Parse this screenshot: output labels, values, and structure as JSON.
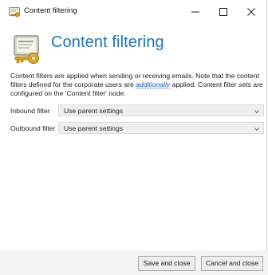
{
  "window": {
    "title": "Content filtering",
    "controls": {
      "minimize": "minimize-icon",
      "maximize": "maximize-icon",
      "close": "close-icon"
    }
  },
  "header": {
    "title": "Content filtering",
    "icon": "certificate-key-icon"
  },
  "description": {
    "part1": "Content filters are applied when sending or receiving emails. Note that the content filters defined for the corporate users are ",
    "emphasis": "additionally",
    "part2": " applied. Content filter sets are configured on the 'Content filter' node."
  },
  "filters": {
    "inbound": {
      "label": "Inbound filter",
      "value": "Use parent settings"
    },
    "outbound": {
      "label": "Outbound filter",
      "value": "Use parent settings"
    }
  },
  "footer": {
    "save_label": "Save and close",
    "cancel_label": "Cancel and close"
  },
  "colors": {
    "accent": "#1f72b8",
    "link": "#1f5aa8",
    "footer_bg": "#f3f3f3",
    "select_bg": "#efefef"
  }
}
